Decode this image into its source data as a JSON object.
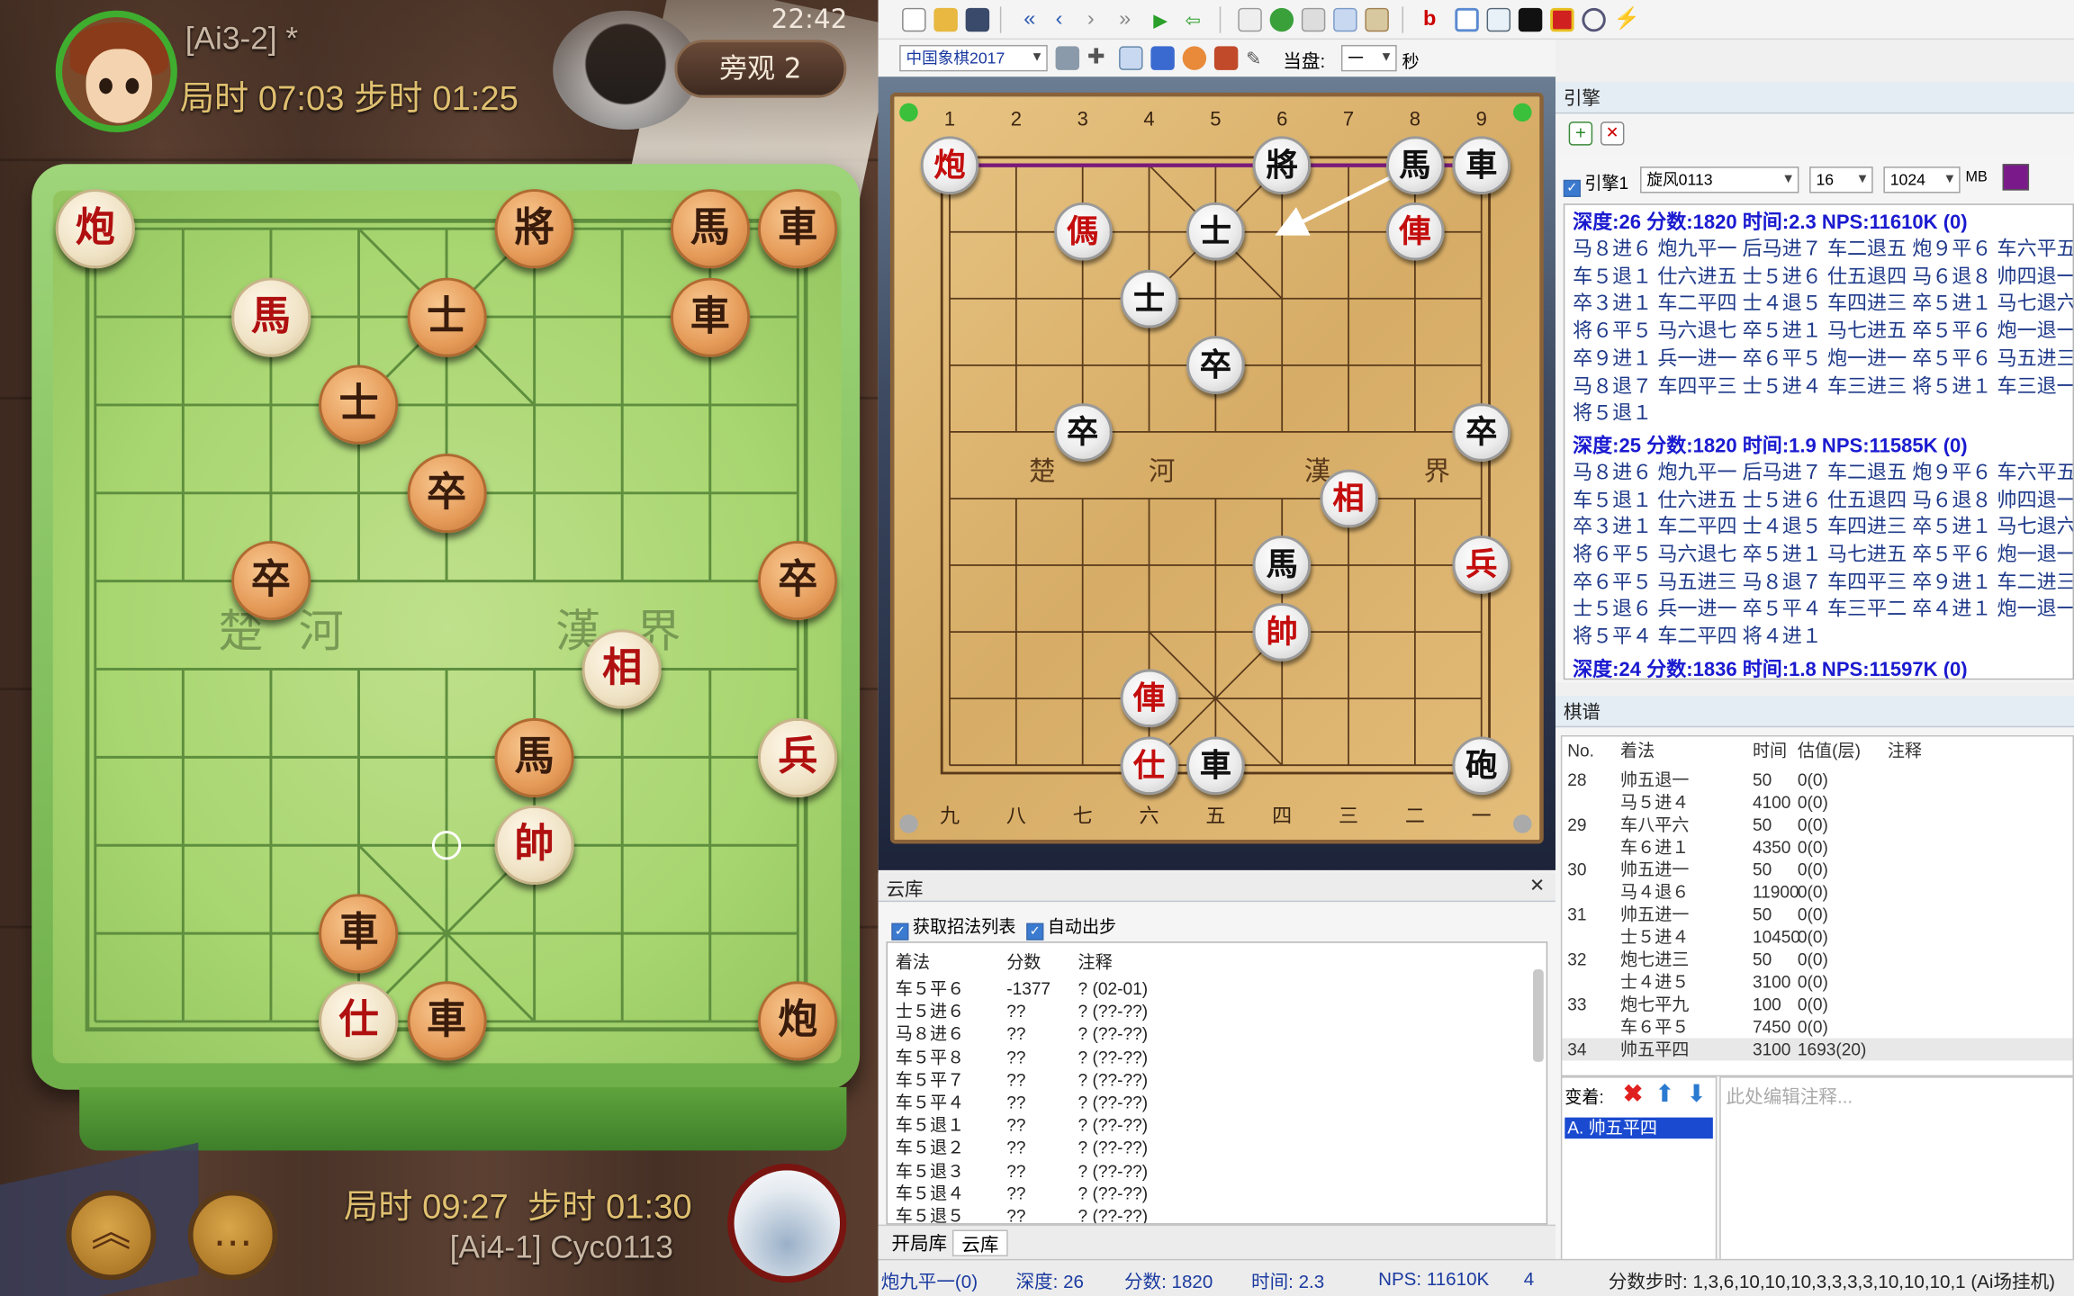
{
  "game": {
    "top_player": {
      "name": "[Ai3-2] *",
      "game_time_label": "局时",
      "game_time": "07:03",
      "step_time_label": "步时",
      "step_time": "01:25"
    },
    "clock": "22:42",
    "spectate": {
      "label": "旁观",
      "count": "2"
    },
    "river": {
      "left": "楚 河",
      "right": "漢 界"
    },
    "bottom_player": {
      "name": "[Ai4-1] Cyc0113",
      "game_time_label": "局时",
      "game_time": "09:27",
      "step_time_label": "步时",
      "step_time": "01:30"
    },
    "pieces": [
      {
        "c": 0,
        "r": 0,
        "t": "炮",
        "s": "red"
      },
      {
        "c": 5,
        "r": 0,
        "t": "將",
        "s": "blk"
      },
      {
        "c": 7,
        "r": 0,
        "t": "馬",
        "s": "blk"
      },
      {
        "c": 8,
        "r": 0,
        "t": "車",
        "s": "blk"
      },
      {
        "c": 2,
        "r": 1,
        "t": "馬",
        "s": "red"
      },
      {
        "c": 4,
        "r": 1,
        "t": "士",
        "s": "blk"
      },
      {
        "c": 7,
        "r": 1,
        "t": "車",
        "s": "blk"
      },
      {
        "c": 3,
        "r": 2,
        "t": "士",
        "s": "blk"
      },
      {
        "c": 4,
        "r": 3,
        "t": "卒",
        "s": "blk"
      },
      {
        "c": 2,
        "r": 4,
        "t": "卒",
        "s": "blk"
      },
      {
        "c": 8,
        "r": 4,
        "t": "卒",
        "s": "blk"
      },
      {
        "c": 6,
        "r": 5,
        "t": "相",
        "s": "red"
      },
      {
        "c": 5,
        "r": 6,
        "t": "馬",
        "s": "blk"
      },
      {
        "c": 8,
        "r": 6,
        "t": "兵",
        "s": "red"
      },
      {
        "c": 5,
        "r": 7,
        "t": "帥",
        "s": "red"
      },
      {
        "c": 3,
        "r": 8,
        "t": "車",
        "s": "blk"
      },
      {
        "c": 3,
        "r": 9,
        "t": "仕",
        "s": "red"
      },
      {
        "c": 4,
        "r": 9,
        "t": "車",
        "s": "blk"
      },
      {
        "c": 8,
        "r": 9,
        "t": "炮",
        "s": "blk"
      }
    ]
  },
  "toolbar": {
    "engine_select": "中国象棋2017",
    "current_label": "当盘:",
    "current_value": "一",
    "seconds_label": "秒"
  },
  "analysis_board": {
    "file_numbers_top": [
      "1",
      "2",
      "3",
      "4",
      "5",
      "6",
      "7",
      "8",
      "9"
    ],
    "file_numbers_bottom": [
      "九",
      "八",
      "七",
      "六",
      "五",
      "四",
      "三",
      "二",
      "一"
    ],
    "river": {
      "left": "楚  河",
      "right": "漢  界"
    },
    "pieces": [
      {
        "c": 0,
        "r": 0,
        "t": "炮",
        "s": "red"
      },
      {
        "c": 5,
        "r": 0,
        "t": "將",
        "s": "blk"
      },
      {
        "c": 7,
        "r": 0,
        "t": "馬",
        "s": "blk"
      },
      {
        "c": 8,
        "r": 0,
        "t": "車",
        "s": "blk"
      },
      {
        "c": 2,
        "r": 1,
        "t": "傌",
        "s": "red"
      },
      {
        "c": 4,
        "r": 1,
        "t": "士",
        "s": "blk"
      },
      {
        "c": 7,
        "r": 1,
        "t": "俥",
        "s": "red"
      },
      {
        "c": 3,
        "r": 2,
        "t": "士",
        "s": "blk"
      },
      {
        "c": 4,
        "r": 3,
        "t": "卒",
        "s": "blk"
      },
      {
        "c": 2,
        "r": 4,
        "t": "卒",
        "s": "blk"
      },
      {
        "c": 8,
        "r": 4,
        "t": "卒",
        "s": "blk"
      },
      {
        "c": 6,
        "r": 5,
        "t": "相",
        "s": "red"
      },
      {
        "c": 5,
        "r": 6,
        "t": "馬",
        "s": "blk"
      },
      {
        "c": 8,
        "r": 6,
        "t": "兵",
        "s": "red"
      },
      {
        "c": 5,
        "r": 7,
        "t": "帥",
        "s": "red"
      },
      {
        "c": 3,
        "r": 8,
        "t": "俥",
        "s": "red"
      },
      {
        "c": 3,
        "r": 9,
        "t": "仕",
        "s": "red"
      },
      {
        "c": 4,
        "r": 9,
        "t": "車",
        "s": "blk"
      },
      {
        "c": 8,
        "r": 9,
        "t": "砲",
        "s": "blk"
      }
    ],
    "arrows": [
      {
        "from": [
          0,
          0
        ],
        "to": [
          8,
          0
        ],
        "color": "#7a1a7a"
      },
      {
        "from": [
          7,
          0
        ],
        "to": [
          5,
          1
        ],
        "color": "#ffffff"
      }
    ]
  },
  "engine": {
    "title": "引擎",
    "label": "引擎1",
    "name": "旋风0113",
    "threads": "16",
    "hash": "1024",
    "hash_unit": "MB",
    "color": "#7a1a8a",
    "blocks": [
      {
        "header": "深度:26  分数:1820  时间:2.3  NPS:11610K  (0)",
        "lines": [
          "马８进６ 炮九平一 后马进７ 车二退五 炮９平６ 车六平五",
          "车５退１ 仕六进五 士５进６ 仕五退四 马６退８ 帅四退一",
          "卒３进１ 车二平四 士４退５ 车四进三 卒５进１ 马七退六",
          "将６平５ 马六退七 卒５进１ 马七进五 卒５平６ 炮一退一",
          "卒９进１ 兵一进一 卒６平５ 炮一进一 卒５平６ 马五进三",
          "马８退７ 车四平三 士５进４ 车三进三 将５进１ 车三退一",
          "将５退１"
        ]
      },
      {
        "header": "深度:25  分数:1820  时间:1.9  NPS:11585K  (0)",
        "lines": [
          "马８进６ 炮九平一 后马进７ 车二退五 炮９平６ 车六平五",
          "车５退１ 仕六进五 士５进６ 仕五退四 马６退８ 帅四退一",
          "卒３进１ 车二平四 士４退５ 车四进三 卒５进１ 马七退六",
          "将６平５ 马六退七 卒５进１ 马七进五 卒５平６ 炮一退一",
          "卒６平５ 马五进三 马８退７ 车四平三 卒９进１ 车二进三",
          "士５退６ 兵一进一 卒５平４ 车三平二 卒４进１ 炮一退一",
          "将５平４ 车二平四 将４进１"
        ]
      },
      {
        "header": "深度:24  分数:1836  时间:1.8  NPS:11597K  (0)",
        "lines": []
      }
    ]
  },
  "record": {
    "title": "棋谱",
    "columns": [
      "No.",
      "着法",
      "时间",
      "估值(层)",
      "注释"
    ],
    "rows": [
      {
        "no": "28",
        "move": "帅五退一",
        "time": "50",
        "eval": "0(0)"
      },
      {
        "no": "",
        "move": "马５进４",
        "time": "4100",
        "eval": "0(0)"
      },
      {
        "no": "29",
        "move": "车八平六",
        "time": "50",
        "eval": "0(0)"
      },
      {
        "no": "",
        "move": "车６进１",
        "time": "4350",
        "eval": "0(0)"
      },
      {
        "no": "30",
        "move": "帅五进一",
        "time": "50",
        "eval": "0(0)"
      },
      {
        "no": "",
        "move": "马４退６",
        "time": "11900",
        "eval": "0(0)"
      },
      {
        "no": "31",
        "move": "帅五进一",
        "time": "50",
        "eval": "0(0)"
      },
      {
        "no": "",
        "move": "士５进４",
        "time": "10450",
        "eval": "0(0)"
      },
      {
        "no": "32",
        "move": "炮七进三",
        "time": "50",
        "eval": "0(0)"
      },
      {
        "no": "",
        "move": "士４进５",
        "time": "3100",
        "eval": "0(0)"
      },
      {
        "no": "33",
        "move": "炮七平九",
        "time": "100",
        "eval": "0(0)"
      },
      {
        "no": "",
        "move": "车６平５",
        "time": "7450",
        "eval": "0(0)"
      },
      {
        "no": "34",
        "move": "帅五平四",
        "time": "3100",
        "eval": "1693(20)"
      }
    ],
    "variation_label": "变着:",
    "variation_item": "A. 帅五平四",
    "note_placeholder": "此处编辑注释..."
  },
  "cloud": {
    "title": "云库",
    "opt_fetch": "获取招法列表",
    "opt_auto": "自动出步",
    "columns": [
      "着法",
      "分数",
      "注释"
    ],
    "rows": [
      {
        "move": "车５平６",
        "score": "-1377",
        "note": "?  (02-01)"
      },
      {
        "move": "士５进６",
        "score": "??",
        "note": "?  (??-??)"
      },
      {
        "move": "马８进６",
        "score": "??",
        "note": "?  (??-??)"
      },
      {
        "move": "车５平８",
        "score": "??",
        "note": "?  (??-??)"
      },
      {
        "move": "车５平７",
        "score": "??",
        "note": "?  (??-??)"
      },
      {
        "move": "车５平４",
        "score": "??",
        "note": "?  (??-??)"
      },
      {
        "move": "车５退１",
        "score": "??",
        "note": "?  (??-??)"
      },
      {
        "move": "车５退２",
        "score": "??",
        "note": "?  (??-??)"
      },
      {
        "move": "车５退３",
        "score": "??",
        "note": "?  (??-??)"
      },
      {
        "move": "车５退４",
        "score": "??",
        "note": "?  (??-??)"
      },
      {
        "move": "车５退５",
        "score": "??",
        "note": "?  (??-??)"
      }
    ],
    "tab_opening": "开局库",
    "tab_cloud": "云库"
  },
  "status": {
    "move": "炮九平一(0)",
    "depth": "深度: 26",
    "score": "分数: 1820",
    "time": "时间: 2.3",
    "nps": "NPS: 11610K",
    "count": "4",
    "steps": "分数步时: 1,3,6,10,10,10,3,3,3,3,10,10,10,1 (Ai场挂机)"
  }
}
